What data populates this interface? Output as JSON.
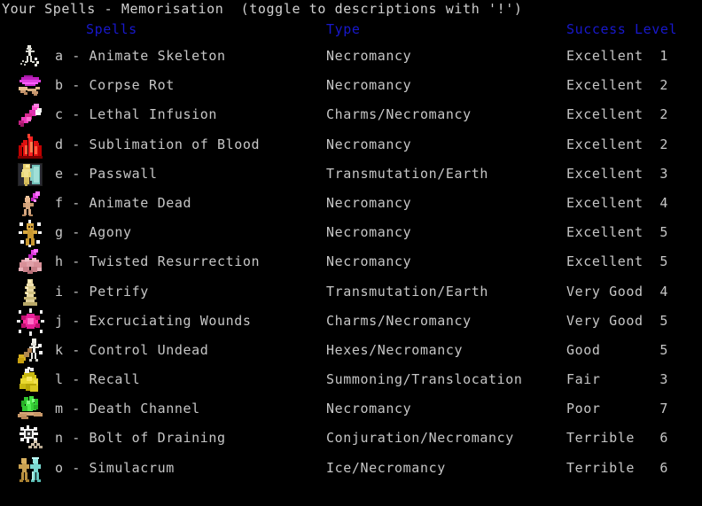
{
  "window": {
    "title_line": "Your Spells - Memorisation  (toggle to descriptions with '!')"
  },
  "columns": {
    "spells": "Spells",
    "type": "Type",
    "success": "Success",
    "level": "Level"
  },
  "colors": {
    "background": "#000000",
    "header_text": "#1818cc",
    "body_text": "#c6c6c6",
    "title_text": "#d0d0d0"
  },
  "spells": [
    {
      "letter": "a",
      "label": "a - Animate Skeleton",
      "name": "Animate Skeleton",
      "type": "Necromancy",
      "success": "Excellent",
      "level": "1",
      "icon": "animate-skeleton-icon"
    },
    {
      "letter": "b",
      "label": "b - Corpse Rot",
      "name": "Corpse Rot",
      "type": "Necromancy",
      "success": "Excellent",
      "level": "2",
      "icon": "corpse-rot-icon"
    },
    {
      "letter": "c",
      "label": "c - Lethal Infusion",
      "name": "Lethal Infusion",
      "type": "Charms/Necromancy",
      "success": "Excellent",
      "level": "2",
      "icon": "lethal-infusion-icon"
    },
    {
      "letter": "d",
      "label": "d - Sublimation of Blood",
      "name": "Sublimation of Blood",
      "type": "Necromancy",
      "success": "Excellent",
      "level": "2",
      "icon": "sublimation-of-blood-icon"
    },
    {
      "letter": "e",
      "label": "e - Passwall",
      "name": "Passwall",
      "type": "Transmutation/Earth",
      "success": "Excellent",
      "level": "3",
      "icon": "passwall-icon"
    },
    {
      "letter": "f",
      "label": "f - Animate Dead",
      "name": "Animate Dead",
      "type": "Necromancy",
      "success": "Excellent",
      "level": "4",
      "icon": "animate-dead-icon"
    },
    {
      "letter": "g",
      "label": "g - Agony",
      "name": "Agony",
      "type": "Necromancy",
      "success": "Excellent",
      "level": "5",
      "icon": "agony-icon"
    },
    {
      "letter": "h",
      "label": "h - Twisted Resurrection",
      "name": "Twisted Resurrection",
      "type": "Necromancy",
      "success": "Excellent",
      "level": "5",
      "icon": "twisted-resurrection-icon"
    },
    {
      "letter": "i",
      "label": "i - Petrify",
      "name": "Petrify",
      "type": "Transmutation/Earth",
      "success": "Very Good",
      "level": "4",
      "icon": "petrify-icon"
    },
    {
      "letter": "j",
      "label": "j - Excruciating Wounds",
      "name": "Excruciating Wounds",
      "type": "Charms/Necromancy",
      "success": "Very Good",
      "level": "5",
      "icon": "excruciating-wounds-icon"
    },
    {
      "letter": "k",
      "label": "k - Control Undead",
      "name": "Control Undead",
      "type": "Hexes/Necromancy",
      "success": "Good",
      "level": "5",
      "icon": "control-undead-icon"
    },
    {
      "letter": "l",
      "label": "l - Recall",
      "name": "Recall",
      "type": "Summoning/Translocation",
      "success": "Fair",
      "level": "3",
      "icon": "recall-icon"
    },
    {
      "letter": "m",
      "label": "m - Death Channel",
      "name": "Death Channel",
      "type": "Necromancy",
      "success": "Poor",
      "level": "7",
      "icon": "death-channel-icon"
    },
    {
      "letter": "n",
      "label": "n - Bolt of Draining",
      "name": "Bolt of Draining",
      "type": "Conjuration/Necromancy",
      "success": "Terrible",
      "level": "6",
      "icon": "bolt-of-draining-icon"
    },
    {
      "letter": "o",
      "label": "o - Simulacrum",
      "name": "Simulacrum",
      "type": "Ice/Necromancy",
      "success": "Terrible",
      "level": "6",
      "icon": "simulacrum-icon"
    }
  ]
}
